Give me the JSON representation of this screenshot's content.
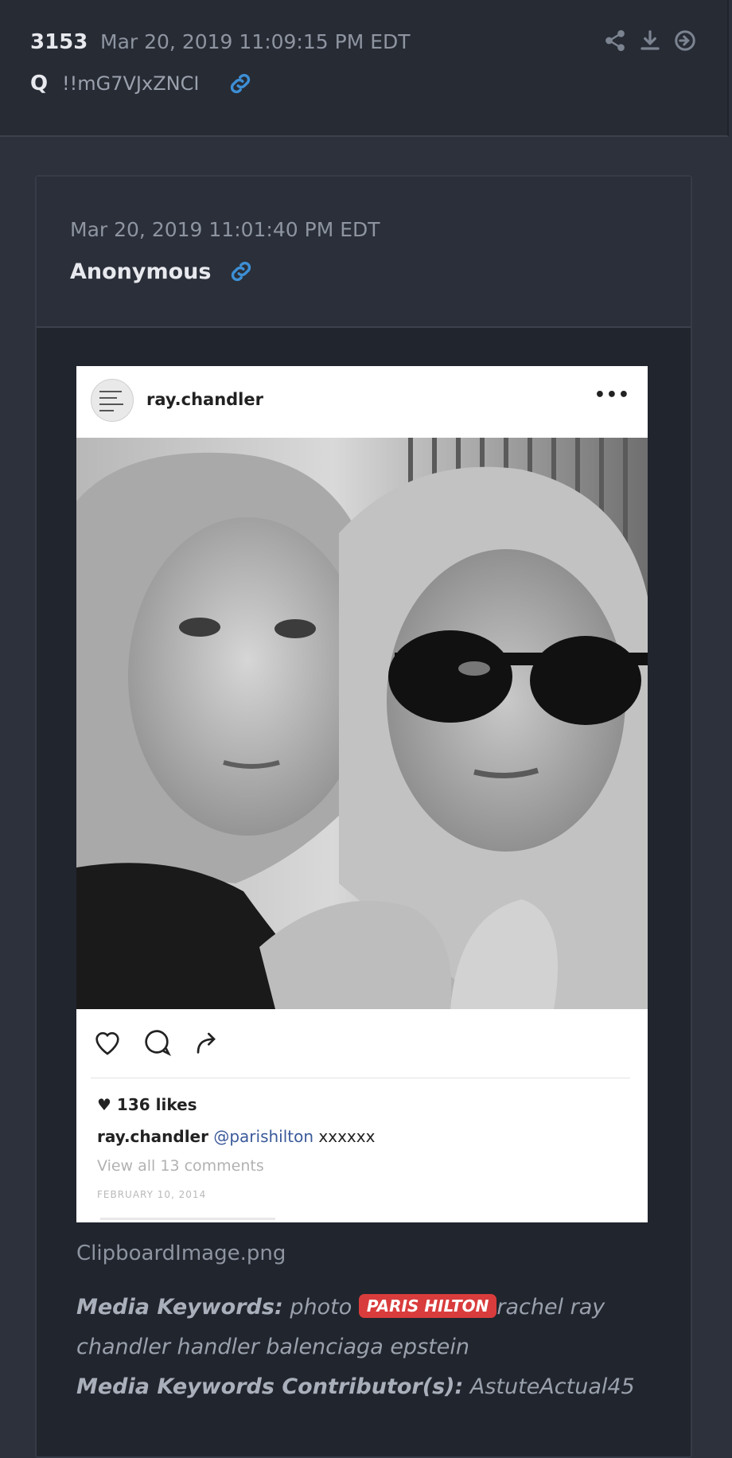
{
  "post": {
    "number": "3153",
    "timestamp": "Mar 20, 2019 11:09:15 PM EDT",
    "author": "Q",
    "tripcode": "!!mG7VJxZNCI",
    "actions": [
      "share-icon",
      "download-icon",
      "go-icon"
    ]
  },
  "quote": {
    "timestamp": "Mar 20, 2019 11:01:40 PM EDT",
    "author": "Anonymous"
  },
  "instagram": {
    "username": "ray.chandler",
    "more": "•••",
    "likes": "136 likes",
    "caption_user": "ray.chandler",
    "caption_mention": "@parishilton",
    "caption_text": " xxxxxx",
    "comments": "View all 13 comments",
    "date": "FEBRUARY 10, 2014"
  },
  "media": {
    "filename": "ClipboardImage.png",
    "keywords_label": "Media Keywords:",
    "keywords_before": "photo",
    "keyword_tag": "PARIS HILTON",
    "keywords_after": "rachel ray chandler handler balenciaga epstein",
    "contributor_label": "Media Keywords Contributor(s):",
    "contributor": "AstuteActual45",
    "tag_color": "#d93c3c"
  }
}
